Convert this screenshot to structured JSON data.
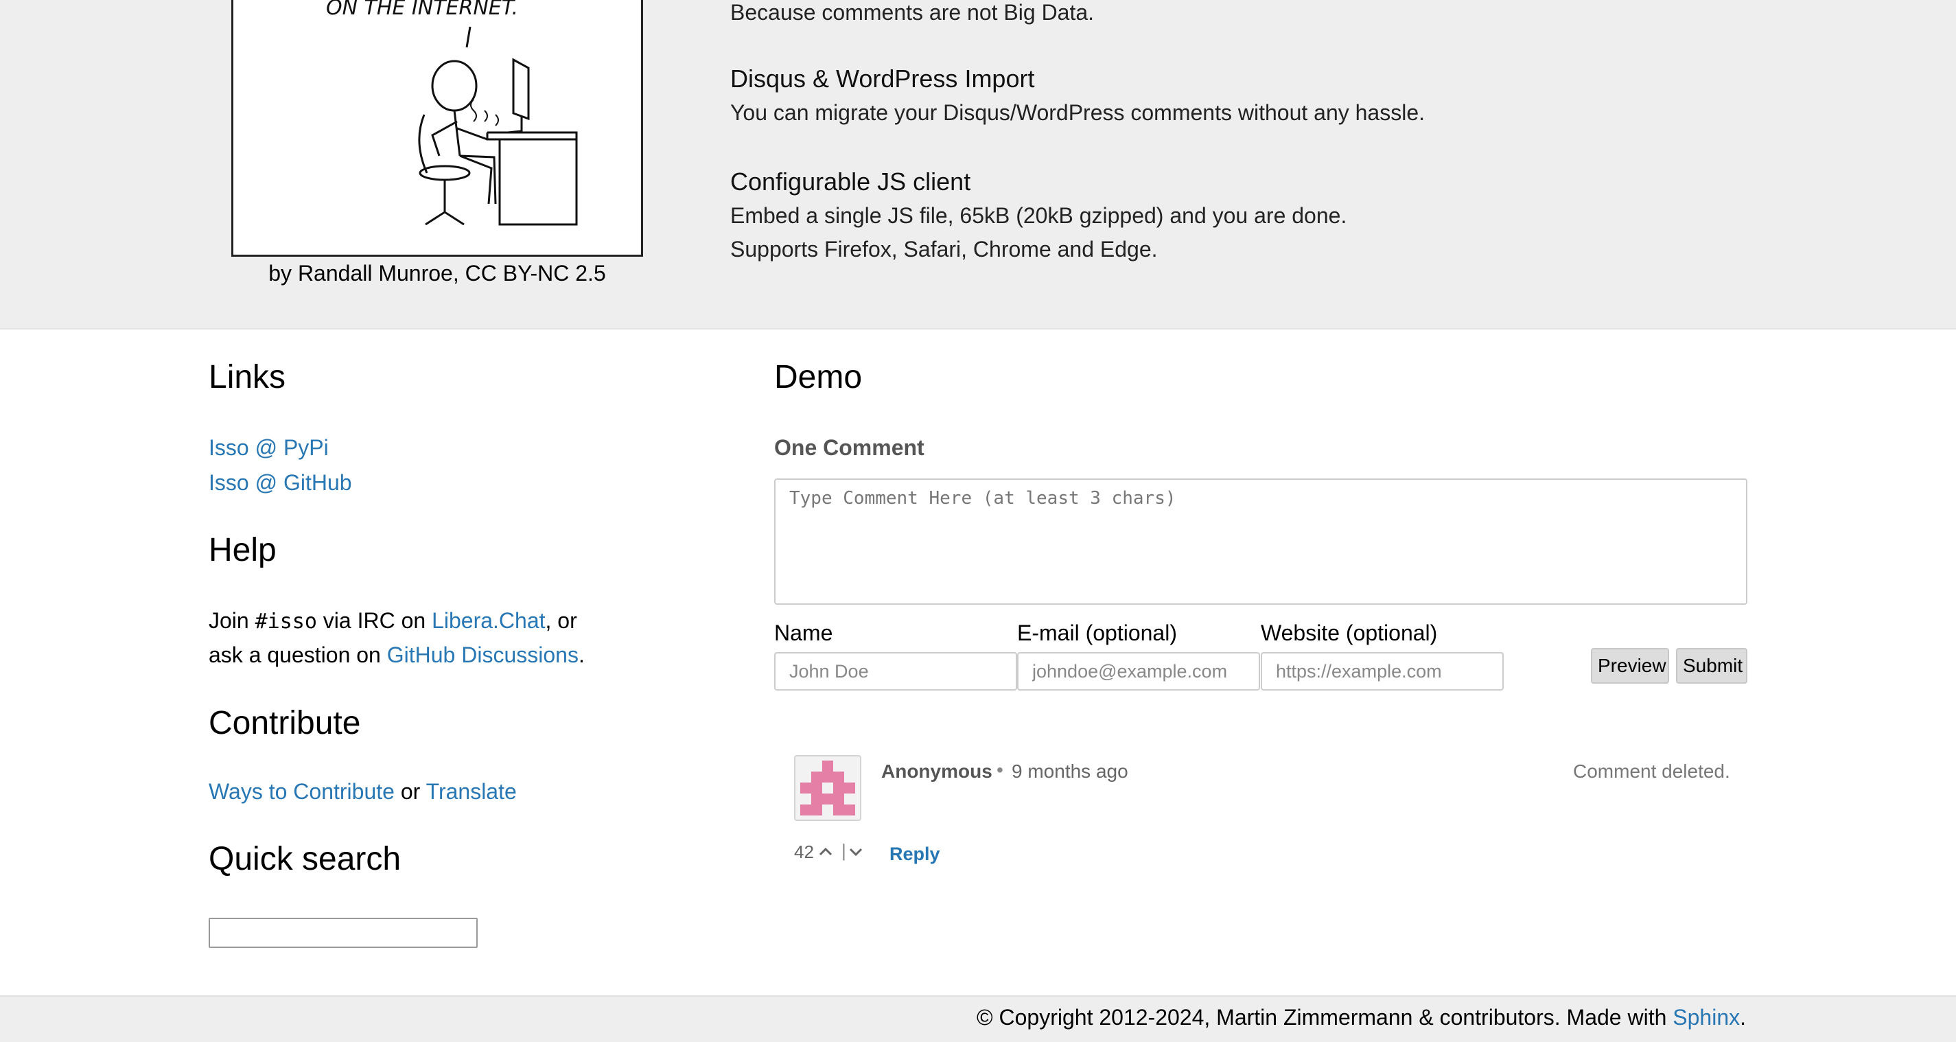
{
  "hero": {
    "feature_intro": "Because comments are not Big Data.",
    "features": [
      {
        "title": "Disqus & WordPress Import",
        "lines": [
          "You can migrate your Disqus/WordPress comments without any hassle."
        ]
      },
      {
        "title": "Configurable JS client",
        "lines": [
          "Embed a single JS file, 65kB (20kB gzipped) and you are done.",
          "Supports Firefox, Safari, Chrome and Edge."
        ]
      }
    ],
    "comic_text": "ON THE  INTERNET.",
    "comic_caption": "by Randall Munroe, CC BY-NC 2.5"
  },
  "sidebar": {
    "links_heading": "Links",
    "links": [
      {
        "label": "Isso @ PyPi"
      },
      {
        "label": "Isso @ GitHub"
      }
    ],
    "help_heading": "Help",
    "help": {
      "prefix": "Join ",
      "code": "#isso",
      "mid": " via IRC on ",
      "libera_link": "Libera.Chat",
      "after_link": ", or",
      "line2_prefix": "ask a question on ",
      "discussions_link": "GitHub Discussions",
      "line2_suffix": "."
    },
    "contribute_heading": "Contribute",
    "contribute": {
      "ways_link": "Ways to Contribute",
      "or": " or ",
      "translate_link": "Translate"
    },
    "search_heading": "Quick search",
    "search_value": ""
  },
  "demo": {
    "heading": "Demo",
    "thread_count": "One Comment",
    "textarea_placeholder": "Type Comment Here (at least 3 chars)",
    "fields": [
      {
        "label": "Name",
        "placeholder": "John Doe"
      },
      {
        "label": "E-mail (optional)",
        "placeholder": "johndoe@example.com"
      },
      {
        "label": "Website (optional)",
        "placeholder": "https://example.com"
      }
    ],
    "preview_label": "Preview",
    "submit_label": "Submit",
    "comment": {
      "author": "Anonymous",
      "separator": "•",
      "timestamp": "9 months ago",
      "text": "Comment deleted.",
      "votes": "42",
      "vote_separator": "|",
      "reply_label": "Reply",
      "avatar_color": "#e57fa6"
    }
  },
  "footer": {
    "copyright": "© Copyright 2012-2024, Martin Zimmermann & contributors. Made with ",
    "sphinx_link": "Sphinx",
    "end": "."
  },
  "colors": {
    "link": "#2877b5",
    "band": "#eeeeee"
  }
}
